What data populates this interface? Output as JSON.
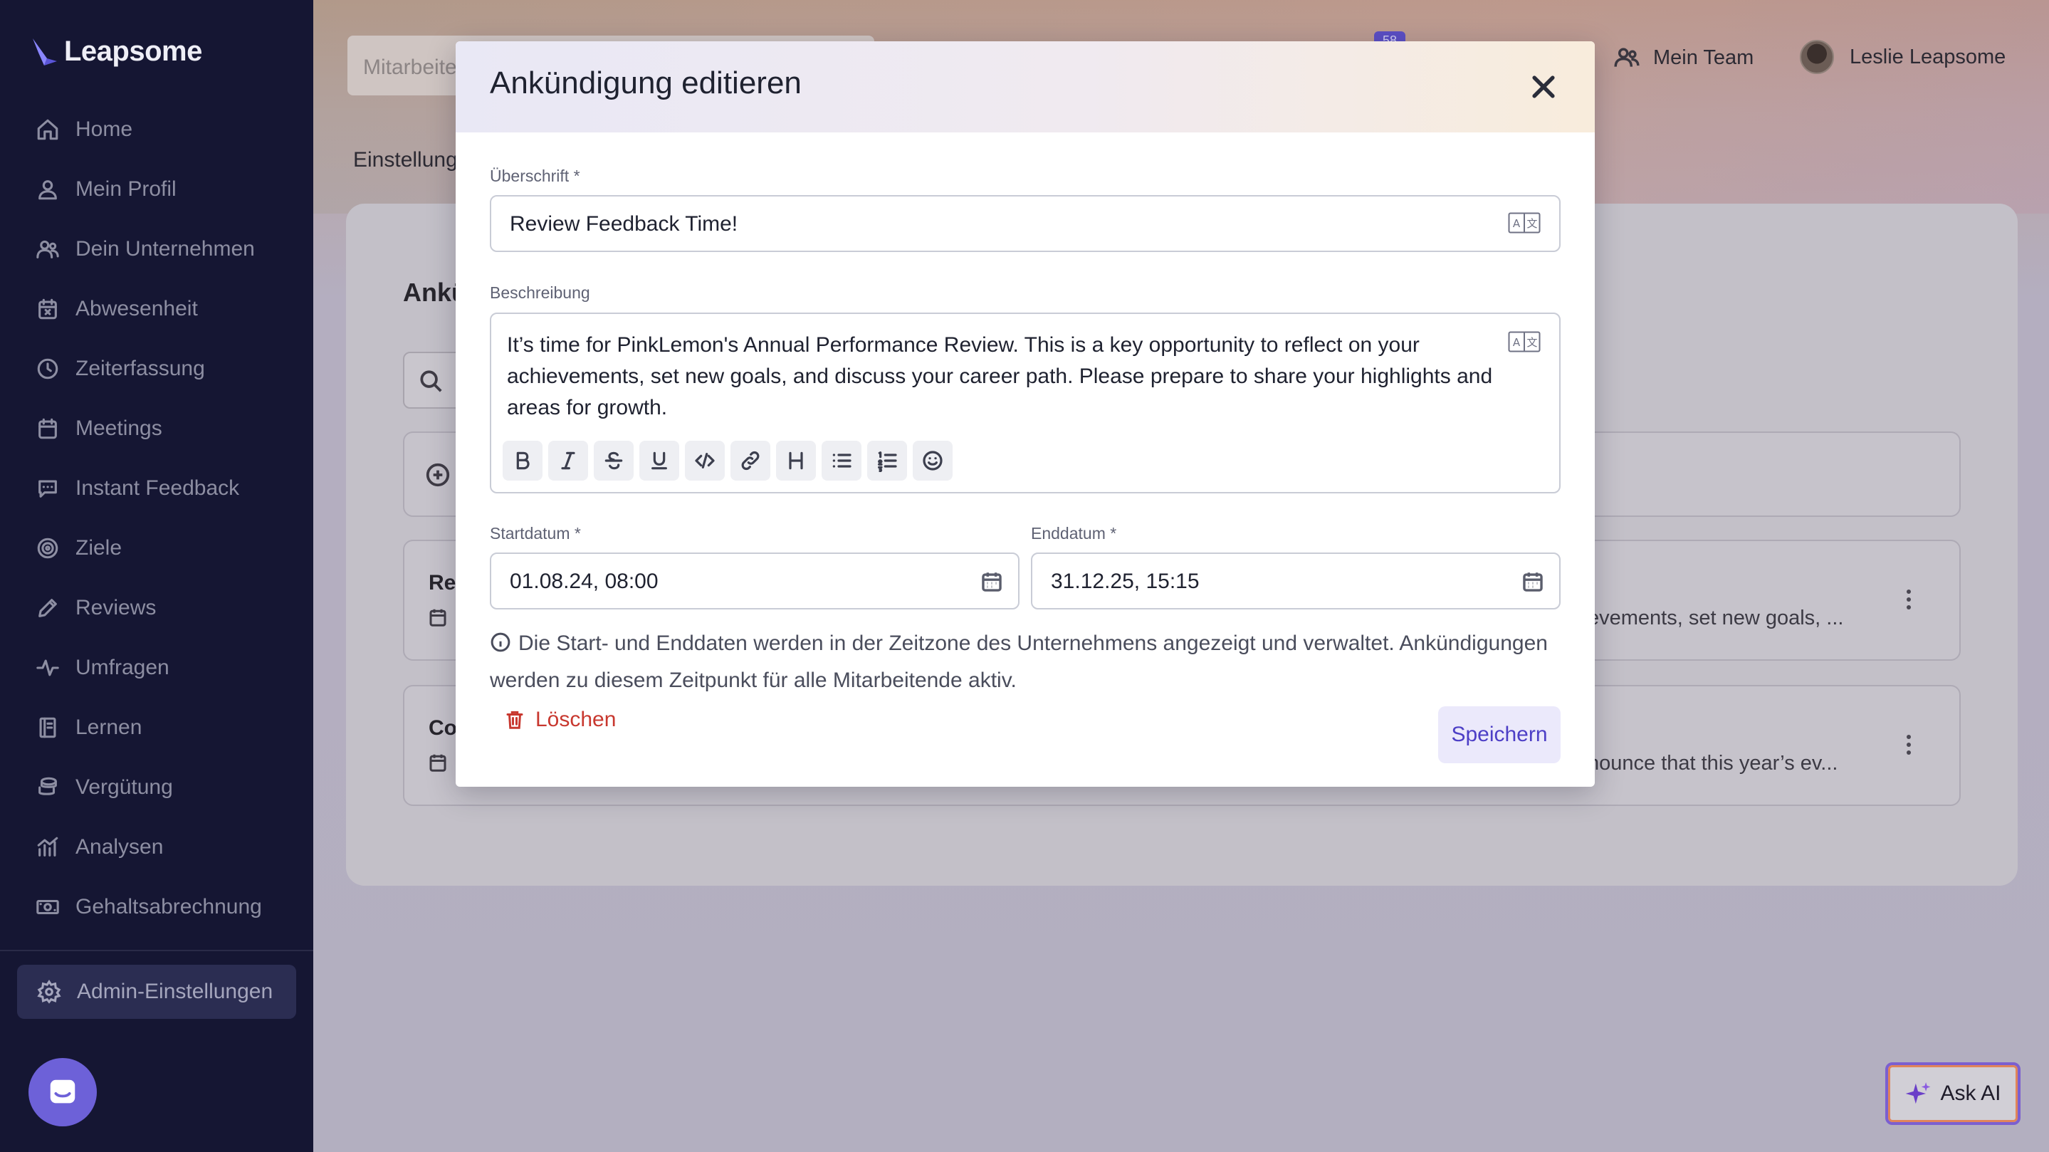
{
  "app": {
    "brand": "Leapsome"
  },
  "sidebar": {
    "items": [
      {
        "label": "Home",
        "icon": "home-icon"
      },
      {
        "label": "Mein Profil",
        "icon": "user-icon"
      },
      {
        "label": "Dein Unternehmen",
        "icon": "users-icon"
      },
      {
        "label": "Abwesenheit",
        "icon": "calendar-x-icon"
      },
      {
        "label": "Zeiterfassung",
        "icon": "clock-icon"
      },
      {
        "label": "Meetings",
        "icon": "calendar-icon"
      },
      {
        "label": "Instant Feedback",
        "icon": "chat-icon"
      },
      {
        "label": "Ziele",
        "icon": "target-icon"
      },
      {
        "label": "Reviews",
        "icon": "pencil-icon"
      },
      {
        "label": "Umfragen",
        "icon": "pulse-icon"
      },
      {
        "label": "Lernen",
        "icon": "book-icon"
      },
      {
        "label": "Vergütung",
        "icon": "coins-icon"
      },
      {
        "label": "Analysen",
        "icon": "chart-icon"
      },
      {
        "label": "Gehaltsabrechnung",
        "icon": "banknote-icon"
      }
    ],
    "admin": {
      "label": "Admin-Einstellungen",
      "icon": "gear-icon"
    }
  },
  "topbar": {
    "search_placeholder": "Mitarbeite",
    "notification_count": "58",
    "team_label": "Mein Team",
    "user_name": "Leslie Leapsome"
  },
  "page": {
    "subnav_label": "Einstellung",
    "card_title": "Ankü",
    "rows": [
      {
        "title": "Rev",
        "desc": "evements, set new goals, ..."
      },
      {
        "title": "Co",
        "desc": "nounce that this year’s ev..."
      }
    ]
  },
  "ask_ai": {
    "label": "Ask AI"
  },
  "modal": {
    "title": "Ankündigung editieren",
    "heading_label": "Überschrift *",
    "heading_value": "Review Feedback Time!",
    "description_label": "Beschreibung",
    "description_value": "It’s time for PinkLemon's Annual Performance Review. This is a key opportunity to reflect on your achievements, set new goals, and discuss your career path. Please prepare to share your highlights and areas for growth.",
    "start_label": "Startdatum *",
    "start_value": "01.08.24, 08:00",
    "end_label": "Enddatum *",
    "end_value": "31.12.25, 15:15",
    "info_text": "Die Start- und Enddaten werden in der Zeitzone des Unternehmens angezeigt und verwaltet. Ankündigungen werden zu diesem Zeitpunkt für alle Mitarbeitende aktiv.",
    "delete_label": "Löschen",
    "save_label": "Speichern"
  }
}
